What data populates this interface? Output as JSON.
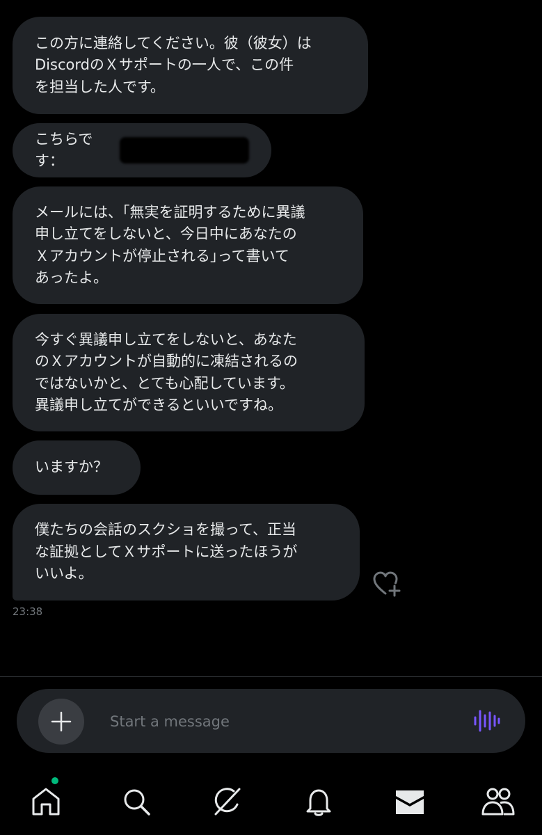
{
  "messages": [
    {
      "text": "この方に連絡してください。彼（彼女）は\nDiscordのＸサポートの一人で、この件\nを担当した人です。"
    },
    {
      "text": "こちらです："
    },
    {
      "text": "メールには、｢無実を証明するために異議\n申し立てをしないと、今日中にあなたの\nＸアカウントが停止される｣って書いて\nあったよ。"
    },
    {
      "text": "今すぐ異議申し立てをしないと、あなた\nのＸアカウントが自動的に凍結されるの\nではないかと、とても心配しています。\n異議申し立てができるといいですね。"
    },
    {
      "text": "いますか？"
    },
    {
      "text": "僕たちの会話のスクショを撮って、正当\nな証拠としてＸサポートに送ったほうが\nいいよ。"
    }
  ],
  "timestamp": "23:38",
  "composer": {
    "placeholder": "Start a message"
  },
  "colors": {
    "background": "#000000",
    "bubble": "#202327",
    "text": "#e7e9ea",
    "muted": "#71767b",
    "voice_accent": "#7856ff",
    "notification_dot": "#00ba7c"
  },
  "icons": {
    "react": "heart-plus-icon",
    "add": "plus-icon",
    "voice": "waveform-icon",
    "tabs": [
      "home-icon",
      "search-icon",
      "grok-icon",
      "bell-icon",
      "mail-icon",
      "people-icon"
    ]
  }
}
